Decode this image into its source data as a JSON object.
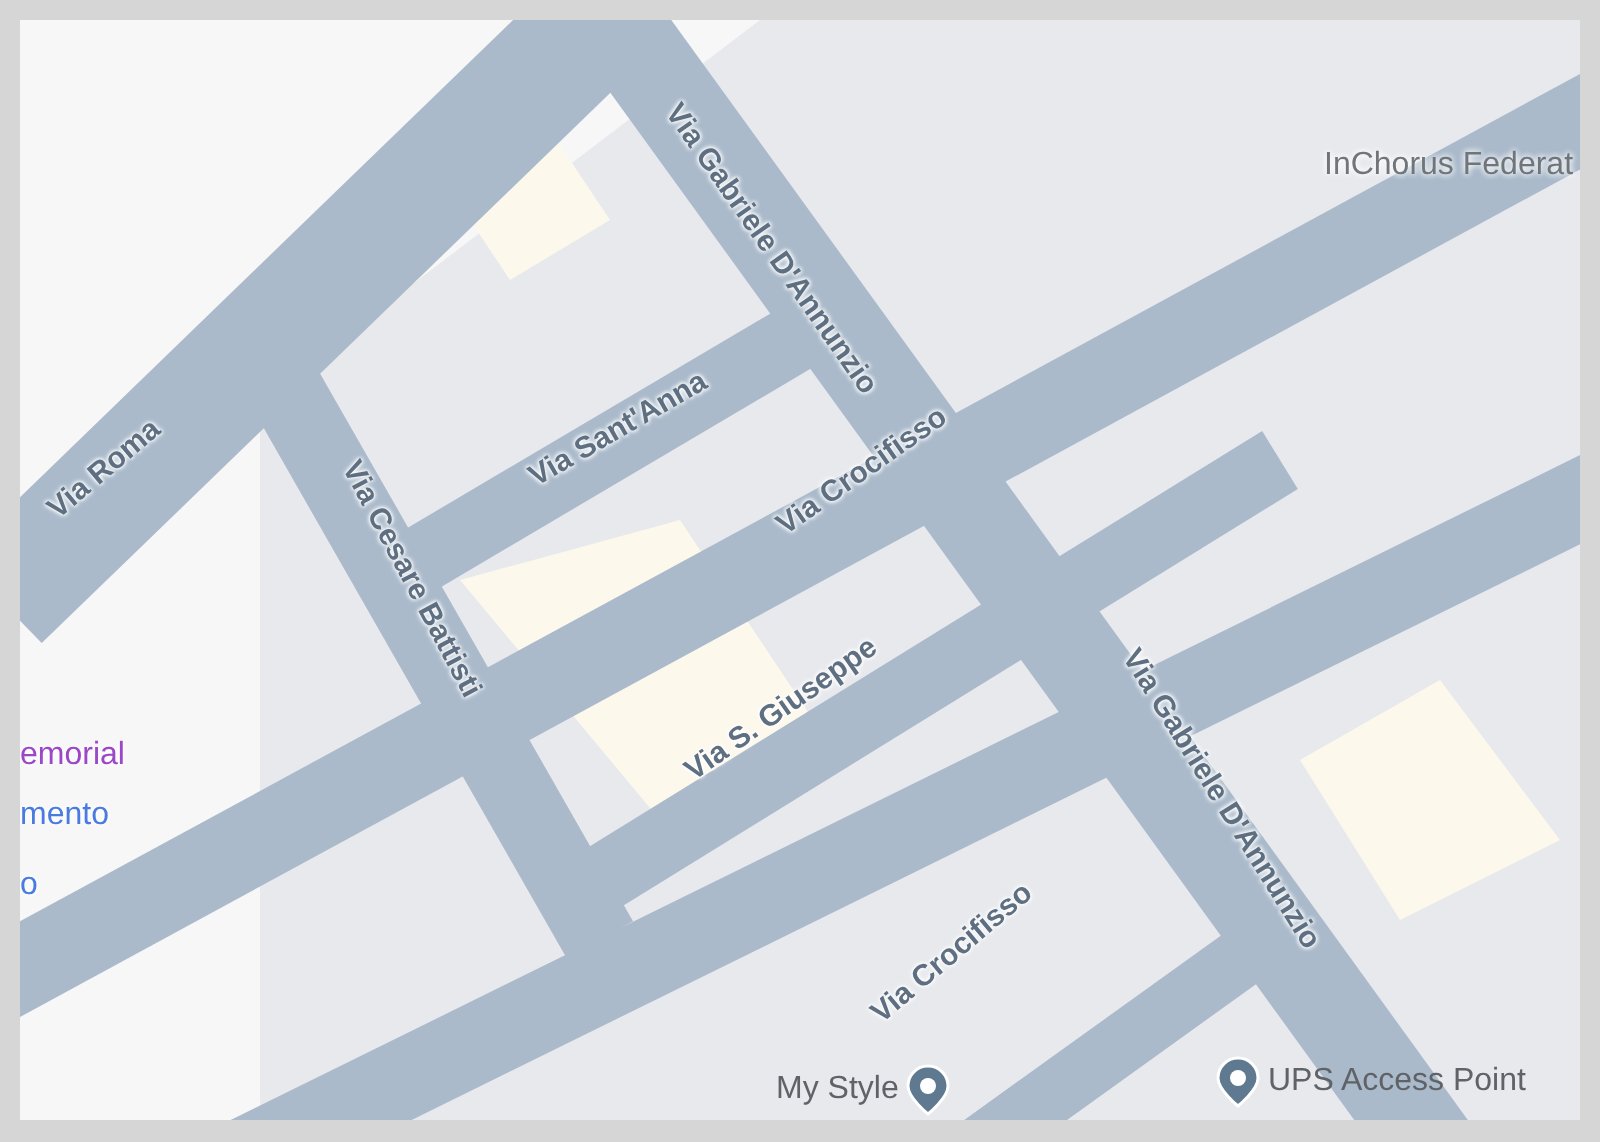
{
  "map": {
    "street_labels": [
      {
        "text": "Via Roma"
      },
      {
        "text": "Via Cesare Battisti"
      },
      {
        "text": "Via Sant'Anna"
      },
      {
        "text": "Via Gabriele D'Annunzio"
      },
      {
        "text": "Via S. Giuseppe"
      },
      {
        "text": "Via Gabriele D'Annunzio"
      },
      {
        "text": "Via Crocifisso"
      },
      {
        "text": "Via Crocifisso"
      }
    ],
    "place_labels": [
      {
        "text": "InChorus Federat",
        "kind": "plain",
        "color": "#70757a"
      },
      {
        "text": "emorial",
        "kind": "plain",
        "color": "#9c46c8"
      },
      {
        "text": "mento",
        "kind": "plain",
        "color": "#4a7be0"
      },
      {
        "text": "o",
        "kind": "plain",
        "color": "#4a7be0"
      },
      {
        "text": "My Style",
        "kind": "pin",
        "color": "#5f6368"
      },
      {
        "text": "UPS Access Point",
        "kind": "pin",
        "color": "#5f6368"
      }
    ]
  }
}
